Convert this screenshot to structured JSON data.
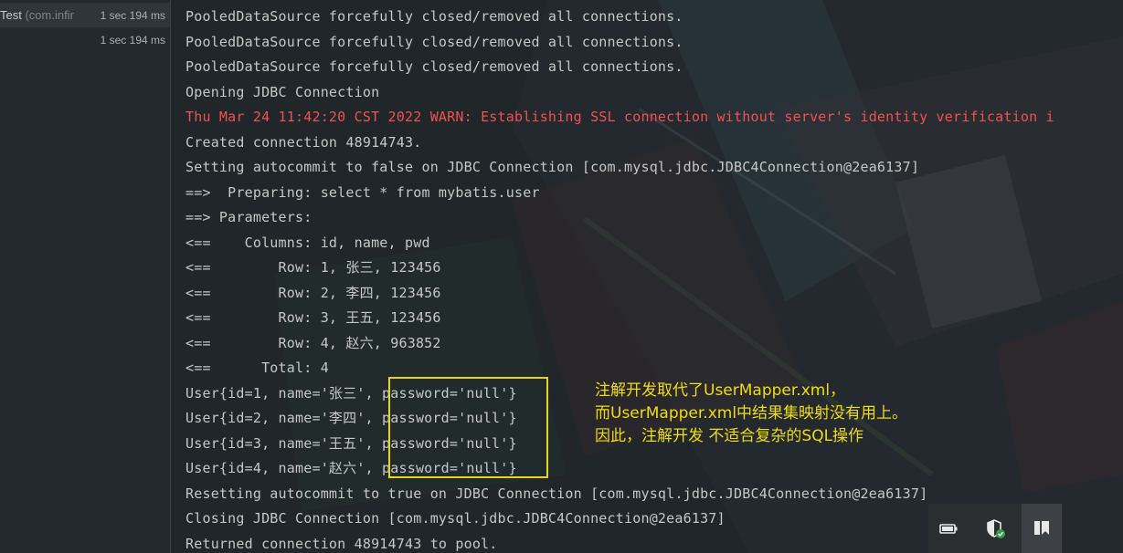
{
  "test_panel": {
    "rows": [
      {
        "name": "Test",
        "pkg": " (com.infir",
        "time": "1 sec 194 ms"
      },
      {
        "name": "",
        "pkg": "",
        "time": "1 sec 194 ms"
      }
    ]
  },
  "console": {
    "lines": [
      {
        "text": "PooledDataSource forcefully closed/removed all connections.",
        "type": "normal"
      },
      {
        "text": "PooledDataSource forcefully closed/removed all connections.",
        "type": "normal"
      },
      {
        "text": "PooledDataSource forcefully closed/removed all connections.",
        "type": "normal"
      },
      {
        "text": "Opening JDBC Connection",
        "type": "normal"
      },
      {
        "text": "Thu Mar 24 11:42:20 CST 2022 WARN: Establishing SSL connection without server's identity verification i",
        "type": "warn"
      },
      {
        "text": "Created connection 48914743.",
        "type": "normal"
      },
      {
        "text": "Setting autocommit to false on JDBC Connection [com.mysql.jdbc.JDBC4Connection@2ea6137]",
        "type": "normal"
      },
      {
        "text": "==>  Preparing: select * from mybatis.user",
        "type": "normal"
      },
      {
        "text": "==> Parameters: ",
        "type": "normal"
      },
      {
        "text": "<==    Columns: id, name, pwd",
        "type": "normal"
      },
      {
        "text": "<==        Row: 1, 张三, 123456",
        "type": "normal"
      },
      {
        "text": "<==        Row: 2, 李四, 123456",
        "type": "normal"
      },
      {
        "text": "<==        Row: 3, 王五, 123456",
        "type": "normal"
      },
      {
        "text": "<==        Row: 4, 赵六, 963852",
        "type": "normal"
      },
      {
        "text": "<==      Total: 4",
        "type": "normal"
      },
      {
        "text": "User{id=1, name='张三', password='null'}",
        "type": "normal"
      },
      {
        "text": "User{id=2, name='李四', password='null'}",
        "type": "normal"
      },
      {
        "text": "User{id=3, name='王五', password='null'}",
        "type": "normal"
      },
      {
        "text": "User{id=4, name='赵六', password='null'}",
        "type": "normal"
      },
      {
        "text": "Resetting autocommit to true on JDBC Connection [com.mysql.jdbc.JDBC4Connection@2ea6137]",
        "type": "normal"
      },
      {
        "text": "Closing JDBC Connection [com.mysql.jdbc.JDBC4Connection@2ea6137]",
        "type": "normal"
      },
      {
        "text": "Returned connection 48914743 to pool.",
        "type": "normal"
      }
    ]
  },
  "annotation": {
    "lines": [
      "注解开发取代了UserMapper.xml，",
      "而UserMapper.xml中结果集映射没有用上。",
      "因此，注解开发  不适合复杂的SQL操作"
    ],
    "color": "#f0dc10"
  },
  "tray": {
    "icons": [
      "battery-icon",
      "security-shield-icon",
      "bookmark-app-icon"
    ]
  },
  "colors": {
    "warn": "#f0524f",
    "text": "#c5c8c6",
    "highlight_border": "#e9d418"
  }
}
